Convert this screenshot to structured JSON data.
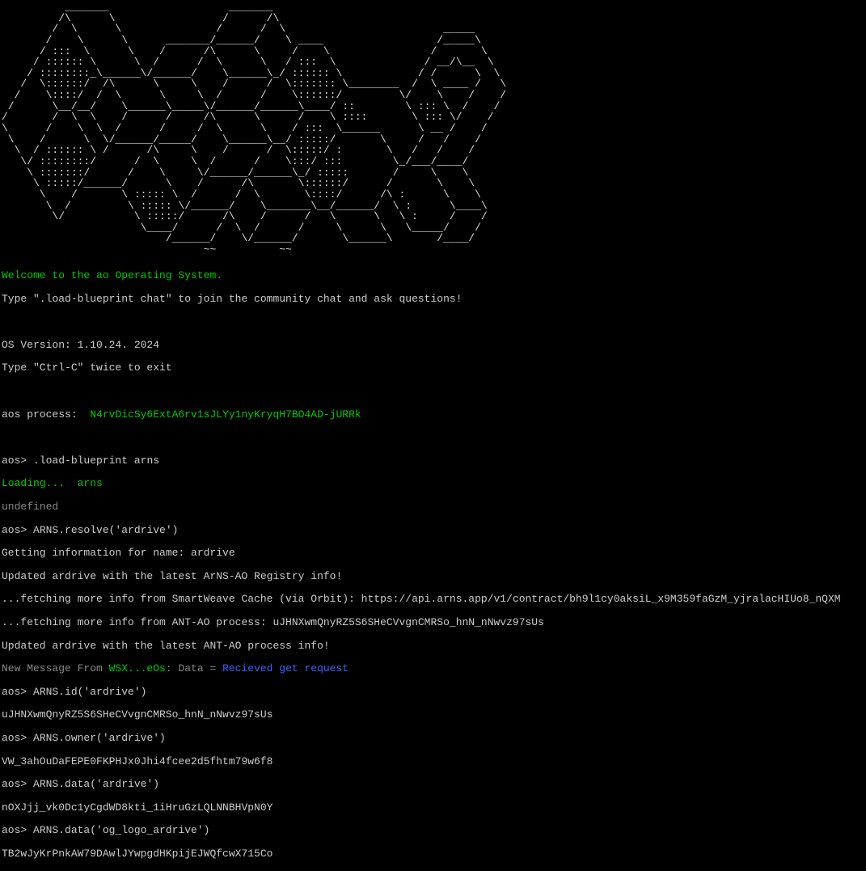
{
  "ascii_logo": "          _______                   _______\n         /\\      \\                 /      /\\\n        /  \\      \\               /      /  \\                         _____\n       /    \\      \\      _______/______/    \\ ____                  /_____\\\n      / :::  \\      \\    /      /\\      \\     /    \\                /       \\\n     / :::::: \\      \\  /      /  \\      \\   / :::  \\              / __/\\__  \\\n    / ::::::::_\\______\\/______/    \\______\\_/ :::::: \\            / /      \\  \\\n   /  \\::::::/  /\\      \\     \\    /      /  \\::::::: \\________  /  \\ ____ /   \\\n  /    \\::::/  /  \\      \\     \\  /      /    \\::::::/         \\/    \\    /    /\n /      \\__/__/    \\______\\_____\\/______/______\\____/ ::        \\ ::: \\  /    /\n/       /  \\  \\    /      /     /\\      \\      /    \\ ::::       \\ ::: \\/    /\n\\      /    \\  \\  /      /     /  \\      \\    / :::  \\______      \\ __ /    /\n \\    /      \\  \\/______/_____/    \\______\\__/ :::::/       \\     /   /    /\n  \\  / :::::: \\ /      /\\     \\    /      /  \\:::::/ :       \\   /   /    /\n   \\/ ::::::::/      /  \\     \\  /      /    \\:::/ :::        \\_/___/____/\n    \\ :::::::/      /    \\     \\/______/______\\_/ :::::       /     \\    \\\n     \\ :::::/______/      \\    /      /\\       \\::::::/      /       \\    \\\n      \\    /       \\ ::::: \\  /      /  \\       \\::::/      /\\ :      \\    \\\n       \\  /         \\ ::::: \\/______/    \\_______\\__/______/  \\ :      \\____\\\n        \\/           \\ :::::/      /\\    /      /   \\      \\   \\ :     /    /\n                      \\____/      /  \\  /      /     \\      \\   \\_____/    /\n                          /______/    \\/______/       \\______\\       /____/\n                                ~~          ~~",
  "welcome": "Welcome to the ao Operating System.",
  "welcome_hint": "Type \".load-blueprint chat\" to join the community chat and ask questions!",
  "os_version": "OS Version: 1.10.24. 2024",
  "exit_hint": "Type \"Ctrl-C\" twice to exit",
  "process_label": "aos process:  ",
  "process_id": "N4rvDicSy6ExtA6rv1sJLYy1nyKryqH7BO4AD-jURRk",
  "prompt": "aos> ",
  "cmd_load": ".load-blueprint arns",
  "loading_label": "Loading...  ",
  "loading_target": "arns",
  "undefined_text": "undefined",
  "cmd_resolve": "ARNS.resolve('ardrive')",
  "getting_info": "Getting information for name: ardrive",
  "updated_registry": "Updated ardrive with the latest ArNS-AO Registry info!",
  "fetch_orbit": "...fetching more info from SmartWeave Cache (via Orbit): https://api.arns.app/v1/contract/bh9l1cy0aksiL_x9M359faGzM_yjralacHIUo8_nQXM",
  "fetch_ant": "...fetching more info from ANT-AO process: uJHNXwmQnyRZ5S6SHeCVvgnCMRSo_hnN_nNwvz97sUs",
  "updated_ant": "Updated ardrive with the latest ANT-AO process info!",
  "msg_prefix": "New Message From ",
  "msg_from": "WSX...eOs",
  "msg_data_label": ": Data = ",
  "msg_data": "Recieved get request",
  "cmd_id": "ARNS.id('ardrive')",
  "result_id": "uJHNXwmQnyRZ5S6SHeCVvgnCMRSo_hnN_nNwvz97sUs",
  "cmd_owner": "ARNS.owner('ardrive')",
  "result_owner": "VW_3ahOuDaFEPE0FKPHJx0Jhi4fcee2d5fhtm79w6f8",
  "cmd_data1": "ARNS.data('ardrive')",
  "result_data1": "nOXJjj_vk0Dc1yCgdWD8kti_1iHruGzLQLNNBHVpN0Y",
  "cmd_data2": "ARNS.data('og_logo_ardrive')",
  "result_data2": "TB2wJyKrPnkAW79DAwlJYwpgdHKpijEJWQfcwX715Co"
}
